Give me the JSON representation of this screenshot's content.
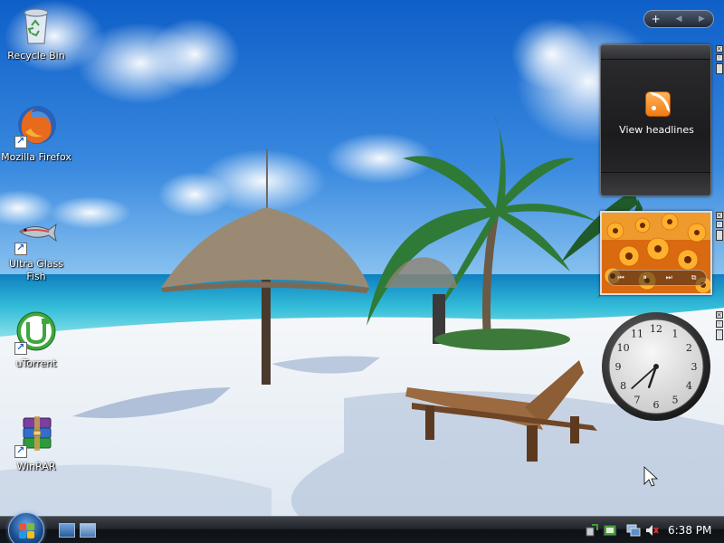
{
  "desktop": {
    "icons": [
      {
        "label": "Recycle Bin",
        "icon": "recycle-bin-icon"
      },
      {
        "label": "Mozilla Firefox",
        "icon": "firefox-icon"
      },
      {
        "label": "Ultra Glass Fish",
        "icon": "fish-icon"
      },
      {
        "label": "uTorrent",
        "icon": "utorrent-icon"
      },
      {
        "label": "WinRAR",
        "icon": "winrar-icon"
      }
    ]
  },
  "sidebar": {
    "controls": {
      "add": "+",
      "prev": "◀",
      "next": "▶"
    },
    "feed_gadget": {
      "text": "View headlines",
      "icon": "rss-icon"
    },
    "slideshow_gadget": {
      "controls": {
        "prev": "⏮",
        "pause": "⏸",
        "next": "⏭",
        "view": "⧉"
      }
    },
    "clock_gadget": {
      "numerals": [
        "12",
        "1",
        "2",
        "3",
        "4",
        "5",
        "6",
        "7",
        "8",
        "9",
        "10",
        "11"
      ],
      "hour": 6,
      "minute": 38
    }
  },
  "taskbar": {
    "start_icon": "windows-start-orb",
    "quick_launch": [
      "show-desktop-icon",
      "switch-windows-icon"
    ],
    "tray_icons": [
      "safely-remove-icon",
      "network-icon",
      "display-icon",
      "volume-muted-icon"
    ],
    "clock": "6:38 PM"
  },
  "colors": {
    "sky": "#1f74d6",
    "sea": "#2bb5d6",
    "sand": "#f4f7fa",
    "taskbar": "#15191e",
    "rss_orange": "#f28a25"
  }
}
